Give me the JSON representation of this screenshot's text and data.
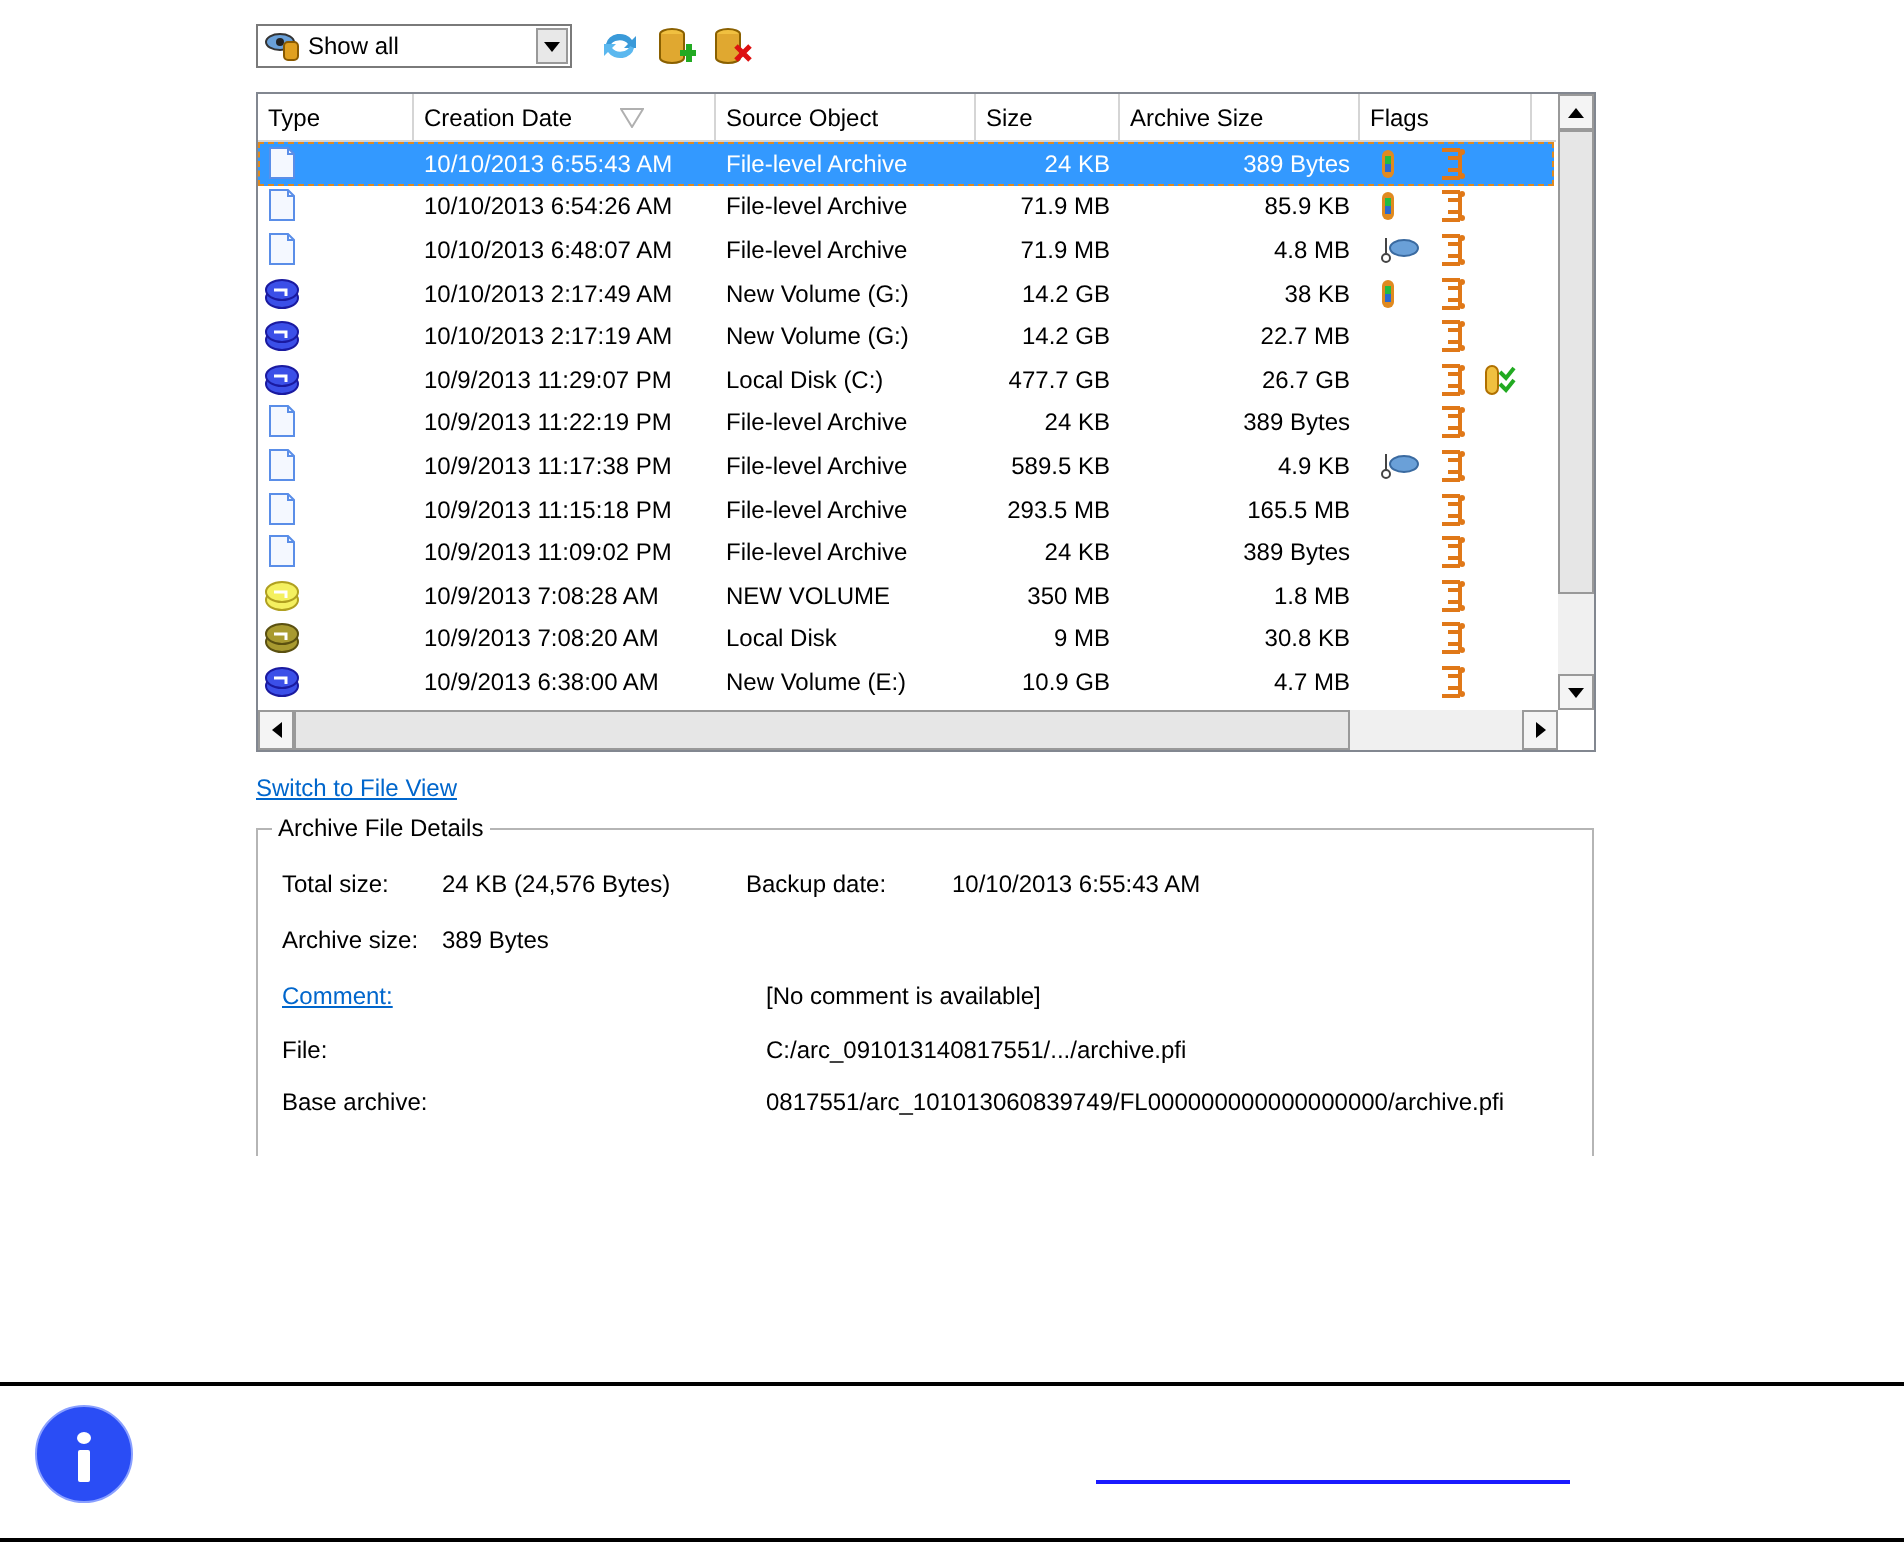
{
  "toolbar": {
    "filter": {
      "value": "Show all"
    }
  },
  "table": {
    "columns": [
      {
        "label": "Type"
      },
      {
        "label": "Creation Date",
        "sorted": true
      },
      {
        "label": "Source Object"
      },
      {
        "label": "Size"
      },
      {
        "label": "Archive Size"
      },
      {
        "label": "Flags"
      }
    ],
    "rows": [
      {
        "kind": "file",
        "date": "10/10/2013 6:55:43 AM",
        "source": "File-level Archive",
        "size": "24 KB",
        "archive_size": "389 Bytes",
        "flags": [
          {
            "kind": "tube"
          },
          {
            "kind": "chain"
          }
        ],
        "selected": true
      },
      {
        "kind": "file",
        "date": "10/10/2013 6:54:26 AM",
        "source": "File-level Archive",
        "size": "71.9 MB",
        "archive_size": "85.9 KB",
        "flags": [
          {
            "kind": "tube"
          },
          {
            "kind": "chain"
          }
        ],
        "selected": false
      },
      {
        "kind": "file",
        "date": "10/10/2013 6:48:07 AM",
        "source": "File-level Archive",
        "size": "71.9 MB",
        "archive_size": "4.8 MB",
        "flags": [
          {
            "kind": "key"
          },
          {
            "kind": "chain"
          }
        ],
        "selected": false
      },
      {
        "kind": "volblue",
        "date": "10/10/2013 2:17:49 AM",
        "source": "New Volume (G:)",
        "size": "14.2 GB",
        "archive_size": "38 KB",
        "flags": [
          {
            "kind": "tube"
          },
          {
            "kind": "chain"
          }
        ],
        "selected": false
      },
      {
        "kind": "volblue",
        "date": "10/10/2013 2:17:19 AM",
        "source": "New Volume (G:)",
        "size": "14.2 GB",
        "archive_size": "22.7 MB",
        "flags": [
          {
            "kind": "chain"
          }
        ],
        "selected": false
      },
      {
        "kind": "volblue",
        "date": "10/9/2013 11:29:07 PM",
        "source": "Local Disk (C:)",
        "size": "477.7 GB",
        "archive_size": "26.7 GB",
        "flags": [
          {
            "kind": "chain"
          },
          {
            "kind": "check"
          }
        ],
        "selected": false
      },
      {
        "kind": "file",
        "date": "10/9/2013 11:22:19 PM",
        "source": "File-level Archive",
        "size": "24 KB",
        "archive_size": "389 Bytes",
        "flags": [
          {
            "kind": "chain"
          }
        ],
        "selected": false
      },
      {
        "kind": "file",
        "date": "10/9/2013 11:17:38 PM",
        "source": "File-level Archive",
        "size": "589.5 KB",
        "archive_size": "4.9 KB",
        "flags": [
          {
            "kind": "key"
          },
          {
            "kind": "chain"
          }
        ],
        "selected": false
      },
      {
        "kind": "file",
        "date": "10/9/2013 11:15:18 PM",
        "source": "File-level Archive",
        "size": "293.5 MB",
        "archive_size": "165.5 MB",
        "flags": [
          {
            "kind": "chain"
          }
        ],
        "selected": false
      },
      {
        "kind": "file",
        "date": "10/9/2013 11:09:02 PM",
        "source": "File-level Archive",
        "size": "24 KB",
        "archive_size": "389 Bytes",
        "flags": [
          {
            "kind": "chain"
          }
        ],
        "selected": false
      },
      {
        "kind": "volyellow",
        "date": "10/9/2013 7:08:28 AM",
        "source": "NEW VOLUME",
        "size": "350 MB",
        "archive_size": "1.8 MB",
        "flags": [
          {
            "kind": "chain"
          }
        ],
        "selected": false
      },
      {
        "kind": "vololive",
        "date": "10/9/2013 7:08:20 AM",
        "source": "Local Disk",
        "size": "9 MB",
        "archive_size": "30.8 KB",
        "flags": [
          {
            "kind": "chain"
          }
        ],
        "selected": false
      },
      {
        "kind": "volblue",
        "date": "10/9/2013 6:38:00 AM",
        "source": "New Volume (E:)",
        "size": "10.9 GB",
        "archive_size": "4.7 MB",
        "flags": [
          {
            "kind": "chain"
          }
        ],
        "selected": false
      }
    ]
  },
  "switch_link": "Switch to File View",
  "details": {
    "title": "Archive File Details",
    "total_size": {
      "label": "Total size:",
      "value": "24 KB (24,576 Bytes)"
    },
    "backup_date": {
      "label": "Backup date:",
      "value": "10/10/2013 6:55:43 AM"
    },
    "archive_size": {
      "label": "Archive size:",
      "value": "389 Bytes"
    },
    "rows": [
      {
        "label": "Comment:",
        "value": "[No comment is available]",
        "link": true
      },
      {
        "label": "File:",
        "value": "C:/arc_091013140817551/.../archive.pfi",
        "link": false
      },
      {
        "label": "Base archive:",
        "value": "0817551/arc_101013060839749/FL000000000000000000/archive.pfi",
        "link": false
      }
    ]
  }
}
